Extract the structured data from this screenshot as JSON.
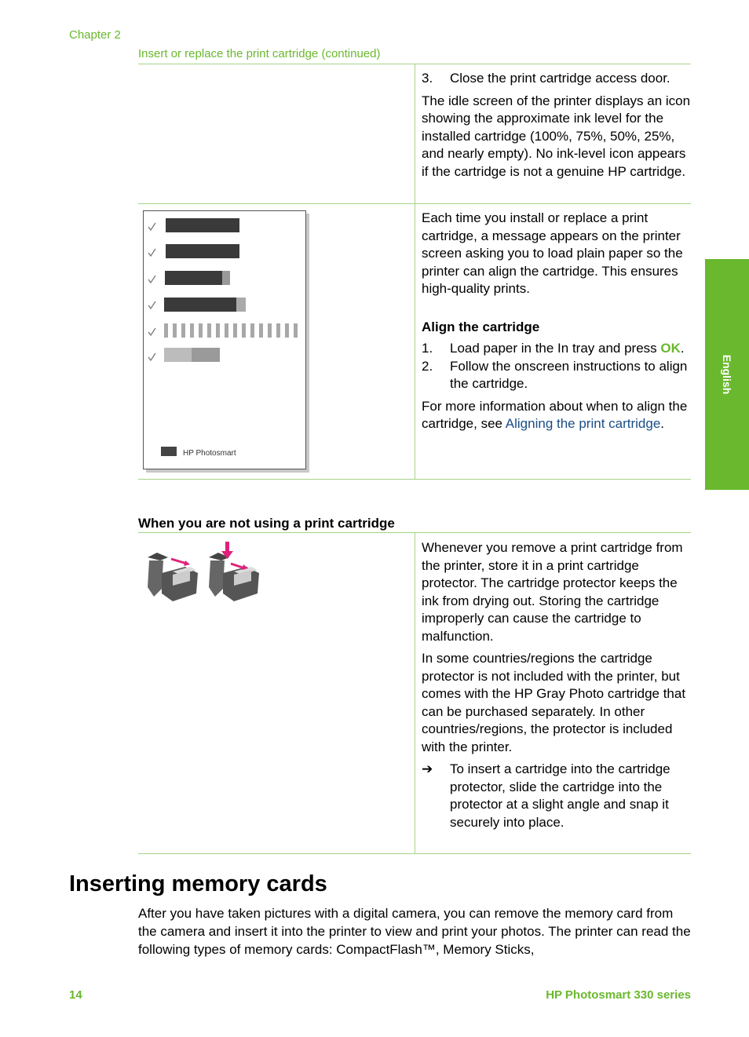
{
  "header": {
    "chapter": "Chapter 2",
    "table_title": "Insert or replace the print cartridge (continued)"
  },
  "side_tab": {
    "label": "English"
  },
  "table1": {
    "row1": {
      "step_num": "3.",
      "step_text": "Close the print cartridge access door.",
      "paragraph": "The idle screen of the printer displays an icon showing the approximate ink level for the installed cartridge (100%, 75%, 50%, 25%, and nearly empty). No ink-level icon appears if the cartridge is not a genuine HP cartridge."
    },
    "row2": {
      "figure": {
        "name": "alignment-page-illustration",
        "logo_text": "HP Photosmart"
      },
      "paragraph": "Each time you install or replace a print cartridge, a message appears on the printer screen asking you to load plain paper so the printer can align the cartridge. This ensures high-quality prints.",
      "subheading": "Align the cartridge",
      "steps": [
        {
          "num": "1.",
          "text": "Load paper in the In tray and press ",
          "button": "OK",
          "after": "."
        },
        {
          "num": "2.",
          "text": "Follow the onscreen instructions to align the cartridge."
        }
      ],
      "more_info_prefix": "For more information about when to align the cartridge, see ",
      "more_info_link": "Aligning the print cartridge",
      "more_info_suffix": "."
    }
  },
  "section2": {
    "heading": "When you are not using a print cartridge",
    "figure": {
      "name": "cartridge-protector-illustration"
    },
    "paragraph1": "Whenever you remove a print cartridge from the printer, store it in a print cartridge protector. The cartridge protector keeps the ink from drying out. Storing the cartridge improperly can cause the cartridge to malfunction.",
    "paragraph2": "In some countries/regions the cartridge protector is not included with the printer, but comes with the HP Gray Photo cartridge that can be purchased separately. In other countries/regions, the protector is included with the printer.",
    "tip_arrow": "➔",
    "tip": "To insert a cartridge into the cartridge protector, slide the cartridge into the protector at a slight angle and snap it securely into place."
  },
  "section3": {
    "heading": "Inserting memory cards",
    "paragraph": "After you have taken pictures with a digital camera, you can remove the memory card from the camera and insert it into the printer to view and print your photos. The printer can read the following types of memory cards: CompactFlash™, Memory Sticks,"
  },
  "footer": {
    "page_number": "14",
    "product": "HP Photosmart 330 series"
  },
  "colors": {
    "accent_green": "#6ab82e",
    "rule_green": "#a6d389",
    "link_blue": "#1a4d85"
  }
}
